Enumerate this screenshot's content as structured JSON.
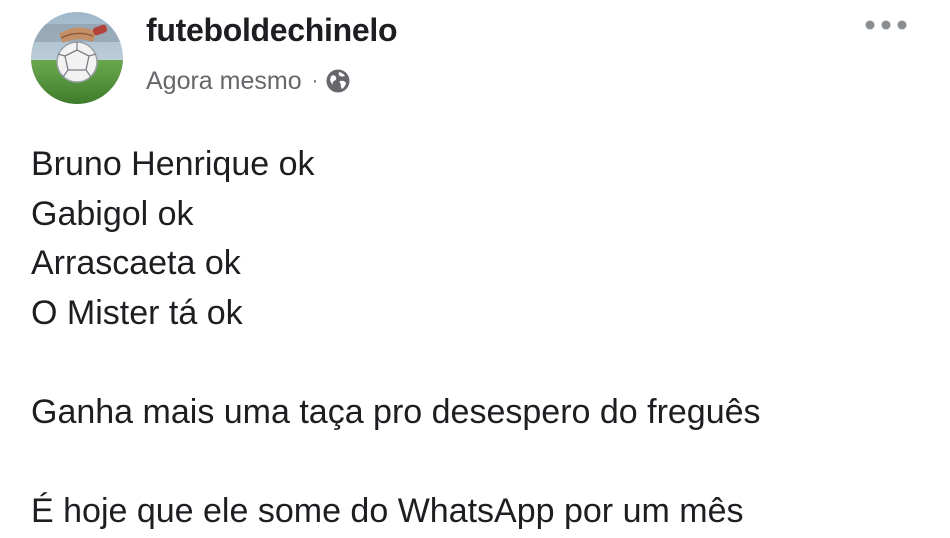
{
  "post": {
    "author": "futeboldechinelo",
    "timestamp": "Agora mesmo",
    "separator": "·",
    "privacy_icon": "globe-icon",
    "more_icon": "more-horizontal-icon",
    "lines": [
      "Bruno Henrique ok",
      "Gabigol ok",
      "Arrascaeta ok",
      "O Mister tá ok",
      "",
      "Ganha mais uma taça pro desespero do freguês",
      "",
      "É hoje que ele some do WhatsApp por um mês"
    ]
  },
  "colors": {
    "text": "#1c1e21",
    "meta_text": "#65676b",
    "background": "#ffffff"
  }
}
